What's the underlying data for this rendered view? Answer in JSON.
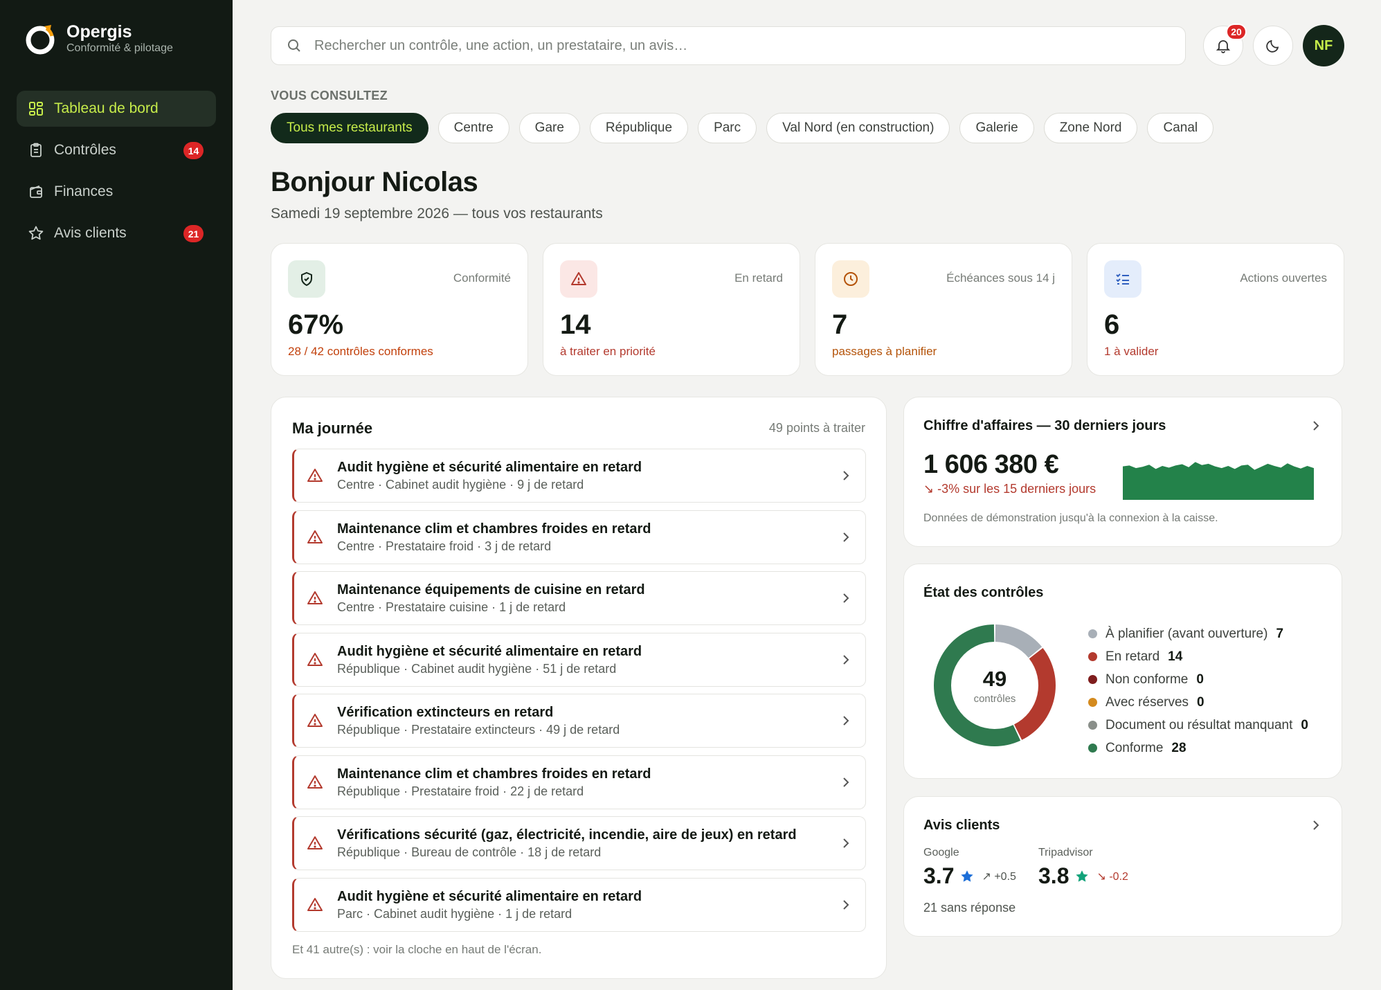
{
  "brand": {
    "name": "Opergis",
    "tagline": "Conformité & pilotage"
  },
  "nav": [
    {
      "label": "Tableau de bord",
      "icon": "dashboard-grid-icon",
      "active": true
    },
    {
      "label": "Contrôles",
      "icon": "clipboard-icon",
      "badge": "14"
    },
    {
      "label": "Finances",
      "icon": "wallet-icon"
    },
    {
      "label": "Avis clients",
      "icon": "star-icon",
      "badge": "21"
    }
  ],
  "search": {
    "placeholder": "Rechercher un contrôle, une action, un prestataire, un avis…"
  },
  "notifications": {
    "count": "20"
  },
  "user": {
    "initials": "NF"
  },
  "scope": {
    "label": "VOUS CONSULTEZ",
    "chips": [
      "Tous mes restaurants",
      "Centre",
      "Gare",
      "République",
      "Parc",
      "Val Nord (en construction)",
      "Galerie",
      "Zone Nord",
      "Canal"
    ],
    "active": "Tous mes restaurants"
  },
  "greeting": {
    "title": "Bonjour Nicolas",
    "subtitle": "Samedi 19 septembre 2026 — tous vos restaurants"
  },
  "kpis": [
    {
      "label": "Conformité",
      "value": "67%",
      "sub": "28 / 42 contrôles conformes",
      "icon": "shield-check-icon",
      "sub_color": "#c2410c"
    },
    {
      "label": "En retard",
      "value": "14",
      "sub": "à traiter en priorité",
      "icon": "warning-triangle-icon",
      "sub_color": "#b33a2e"
    },
    {
      "label": "Échéances sous 14 j",
      "value": "7",
      "sub": "passages à planifier",
      "icon": "clock-icon",
      "sub_color": "#b45309"
    },
    {
      "label": "Actions ouvertes",
      "value": "6",
      "sub": "1 à valider",
      "icon": "checklist-icon",
      "sub_color": "#b33a2e"
    }
  ],
  "journee": {
    "title": "Ma journée",
    "count": "49 points à traiter",
    "tasks": [
      {
        "title": "Audit hygiène et sécurité alimentaire en retard",
        "sub": "Centre · Cabinet audit hygiène · 9 j de retard"
      },
      {
        "title": "Maintenance clim et chambres froides en retard",
        "sub": "Centre · Prestataire froid · 3 j de retard"
      },
      {
        "title": "Maintenance équipements de cuisine en retard",
        "sub": "Centre · Prestataire cuisine · 1 j de retard"
      },
      {
        "title": "Audit hygiène et sécurité alimentaire en retard",
        "sub": "République · Cabinet audit hygiène · 51 j de retard"
      },
      {
        "title": "Vérification extincteurs en retard",
        "sub": "République · Prestataire extincteurs · 49 j de retard"
      },
      {
        "title": "Maintenance clim et chambres froides en retard",
        "sub": "République · Prestataire froid · 22 j de retard"
      },
      {
        "title": "Vérifications sécurité (gaz, électricité, incendie, aire de jeux) en retard",
        "sub": "République · Bureau de contrôle · 18 j de retard"
      },
      {
        "title": "Audit hygiène et sécurité alimentaire en retard",
        "sub": "Parc · Cabinet audit hygiène · 1 j de retard"
      }
    ],
    "more": "Et 41 autre(s) : voir la cloche en haut de l'écran."
  },
  "ca": {
    "title": "Chiffre d'affaires — 30 derniers jours",
    "value": "1 606 380 €",
    "delta": "↘ -3% sur les 15 derniers jours",
    "note": "Données de démonstration jusqu'à la connexion à la caisse.",
    "spark_color": "#23824a",
    "spark": [
      0.78,
      0.8,
      0.74,
      0.77,
      0.82,
      0.72,
      0.79,
      0.75,
      0.8,
      0.83,
      0.76,
      0.88,
      0.81,
      0.84,
      0.78,
      0.74,
      0.79,
      0.72,
      0.8,
      0.82,
      0.7,
      0.77,
      0.84,
      0.79,
      0.75,
      0.85,
      0.78,
      0.73,
      0.79,
      0.74
    ]
  },
  "etat": {
    "title": "État des contrôles",
    "total": "49",
    "total_label": "contrôles",
    "items": [
      {
        "label": "À planifier (avant ouverture)",
        "value": 7,
        "color": "#a8afb7"
      },
      {
        "label": "En retard",
        "value": 14,
        "color": "#b33a2e"
      },
      {
        "label": "Non conforme",
        "value": 0,
        "color": "#7f1d1d"
      },
      {
        "label": "Avec réserves",
        "value": 0,
        "color": "#d48a1e"
      },
      {
        "label": "Document ou résultat manquant",
        "value": 0,
        "color": "#8a8f8a"
      },
      {
        "label": "Conforme",
        "value": 28,
        "color": "#2f7a4f"
      }
    ]
  },
  "avis": {
    "title": "Avis clients",
    "platforms": [
      {
        "name": "Google",
        "score": "3.7",
        "trend": "↗ +0.5",
        "star_color": "#1d6fd8",
        "trend_color": "#4f544f"
      },
      {
        "name": "Tripadvisor",
        "score": "3.8",
        "trend": "↘ -0.2",
        "star_color": "#12a37a",
        "trend_color": "#b33a2e"
      }
    ],
    "unanswered": "21 sans réponse"
  }
}
